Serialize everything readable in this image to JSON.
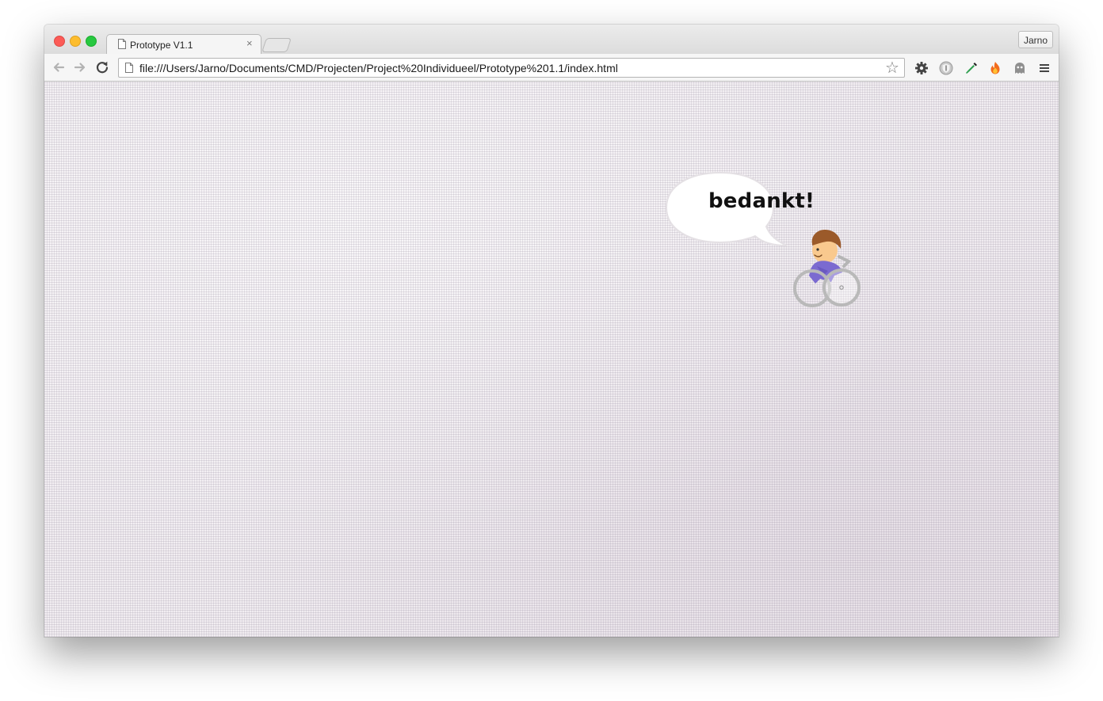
{
  "browser": {
    "tab": {
      "title": "Prototype V1.1",
      "close_glyph": "×",
      "icon": "page-icon"
    },
    "profile_name": "Jarno",
    "toolbar": {
      "back_icon": "back-arrow-icon",
      "forward_icon": "forward-arrow-icon",
      "reload_icon": "reload-icon",
      "url": "file:///Users/Jarno/Documents/CMD/Projecten/Project%20Individueel/Prototype%201.1/index.html",
      "bookmark_icon": "star-icon"
    },
    "extensions": [
      {
        "name": "gear-icon"
      },
      {
        "name": "shield-icon"
      },
      {
        "name": "eyedropper-icon"
      },
      {
        "name": "flame-icon"
      },
      {
        "name": "ghost-icon"
      },
      {
        "name": "menu-icon"
      }
    ]
  },
  "page": {
    "speech_text": "bedankt!",
    "background": "linen-texture",
    "character": "wheelchair-user-illustration"
  },
  "colors": {
    "close_red": "#fc5b57",
    "minimize_yellow": "#fdbd2e",
    "zoom_green": "#27c840",
    "background": "#f1edf1",
    "shirt_purple": "#7b6ad0",
    "hair_brown": "#9b5a2a",
    "skin": "#f9c98e"
  }
}
